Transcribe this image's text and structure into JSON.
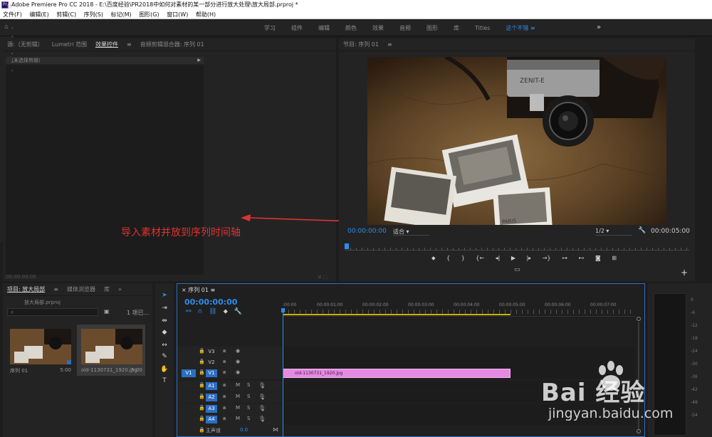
{
  "window": {
    "app_icon": "Pr",
    "title": "Adobe Premiere Pro CC 2018 - E:\\百度经验\\PR2018中如何对素材的某一部分进行放大处理\\放大局部.prproj *"
  },
  "menu": [
    "文件(F)",
    "编辑(E)",
    "剪辑(C)",
    "序列(S)",
    "标记(M)",
    "图形(G)",
    "窗口(W)",
    "帮助(H)"
  ],
  "workspaces": {
    "tabs": [
      "学习",
      "组件",
      "编辑",
      "颜色",
      "效果",
      "音频",
      "图形",
      "库",
      "Titles",
      "这个不错"
    ],
    "active": "这个不错",
    "menu_glyph": "≡",
    "more": "»"
  },
  "source_panel": {
    "tabs": [
      "源:（无剪辑）",
      "Lumetri 范围",
      "效果控件",
      "≡",
      "音频剪辑混合器: 序列 01"
    ],
    "active_tab": "效果控件",
    "sub_header": "（未选择剪辑）",
    "timecode": "00:00:00:00",
    "annotation": "导入素材并放到序列时间轴"
  },
  "program_panel": {
    "title": "节目: 序列 01",
    "menu_glyph": "≡",
    "time_current": "00:00:00:00",
    "fit": "适合",
    "resolution": "1/2",
    "time_duration": "00:00:05:00",
    "controls": [
      "marker-icon",
      "mark-in-icon",
      "mark-out-icon",
      "go-to-in-icon",
      "step-back-icon",
      "play-icon",
      "step-forward-icon",
      "go-to-out-icon",
      "lift-icon",
      "extract-icon",
      "export-frame-icon",
      "button-editor-icon"
    ]
  },
  "effects_panel": {
    "tab": "效"
  },
  "project_panel": {
    "tabs": [
      "项目: 放大局部",
      "≡",
      "媒体浏览器",
      "库",
      "»"
    ],
    "active_tab": "项目: 放大局部",
    "project_file": "放大局部.prproj",
    "item_count": "1 项已...",
    "items": [
      {
        "name": "序列 01",
        "duration": "5:00"
      },
      {
        "name": "old-1130731_1920.jpg",
        "duration": "5:00"
      }
    ]
  },
  "timeline": {
    "close_glyph": "×",
    "title": "序列 01",
    "menu_glyph": "≡",
    "timecode": "00:00:00:00",
    "ruler": [
      ":00:00",
      "00:00:01:00",
      "00:00:02:00",
      "00:00:03:00",
      "00:00:04:00",
      "00:00:05:00",
      "00:00:06:00",
      "00:00:07:00"
    ],
    "tracks": [
      {
        "src": "",
        "name": "V3",
        "kind": "video"
      },
      {
        "src": "",
        "name": "V2",
        "kind": "video"
      },
      {
        "src": "V1",
        "name": "V1",
        "kind": "video",
        "clip": "old-1130731_1920.jpg"
      },
      {
        "src": "",
        "name": "A1",
        "kind": "audio"
      },
      {
        "src": "",
        "name": "A2",
        "kind": "audio"
      },
      {
        "src": "",
        "name": "A3",
        "kind": "audio"
      },
      {
        "src": "",
        "name": "A4",
        "kind": "audio"
      }
    ],
    "audio_labels": {
      "mute": "M",
      "solo": "S"
    },
    "master": {
      "name": "主声道",
      "value": "0.0"
    }
  },
  "audio_meter": {
    "scale": [
      "0",
      "-6",
      "-12",
      "-18",
      "-24",
      "-30",
      "-36",
      "-42",
      "-48",
      "-54"
    ]
  },
  "watermark": {
    "text": "Bai 经验",
    "url": "jingyan.baidu.com"
  },
  "colors": {
    "accent_blue": "#2d8ceb",
    "clip_pink": "#e58ae3",
    "annotation_red": "#e03131"
  }
}
